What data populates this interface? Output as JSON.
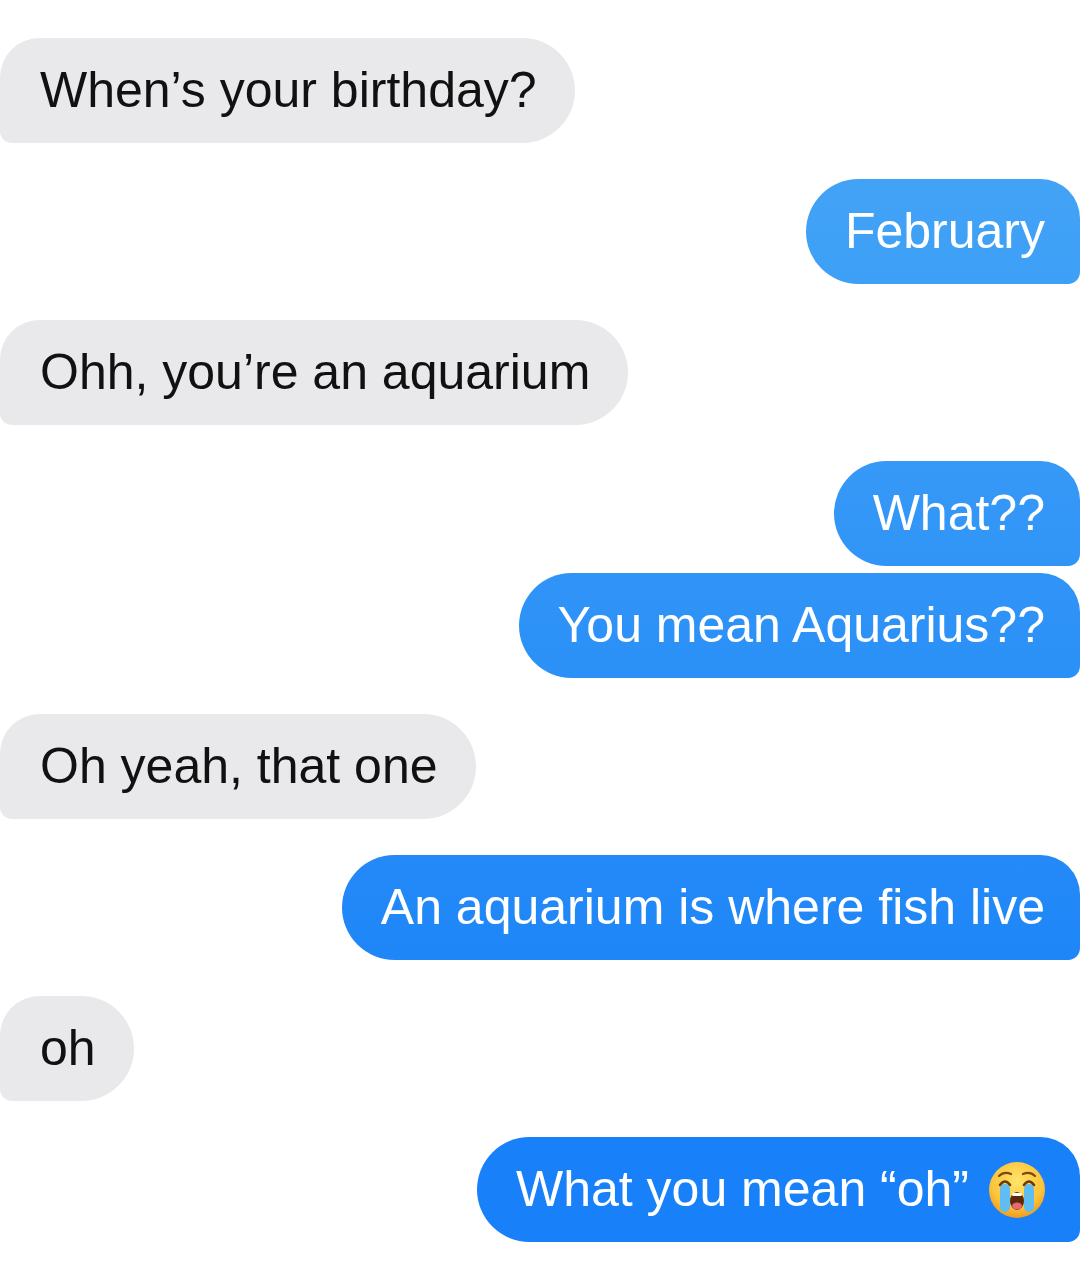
{
  "messages": [
    {
      "kind": "received",
      "text": "When’s your birthday?",
      "emoji": false
    },
    {
      "kind": "sent",
      "text": "February",
      "emoji": false
    },
    {
      "kind": "received",
      "text": "Ohh, you’re an aquarium",
      "emoji": false
    },
    {
      "kind": "sent",
      "text": "What??",
      "emoji": false
    },
    {
      "kind": "sent",
      "text": "You mean Aquarius??",
      "emoji": false
    },
    {
      "kind": "received",
      "text": "Oh yeah, that one",
      "emoji": false
    },
    {
      "kind": "sent",
      "text": "An aquarium is where fish live",
      "emoji": false
    },
    {
      "kind": "received",
      "text": "oh",
      "emoji": false
    },
    {
      "kind": "sent",
      "text": "What you mean “oh”",
      "emoji": true
    }
  ]
}
